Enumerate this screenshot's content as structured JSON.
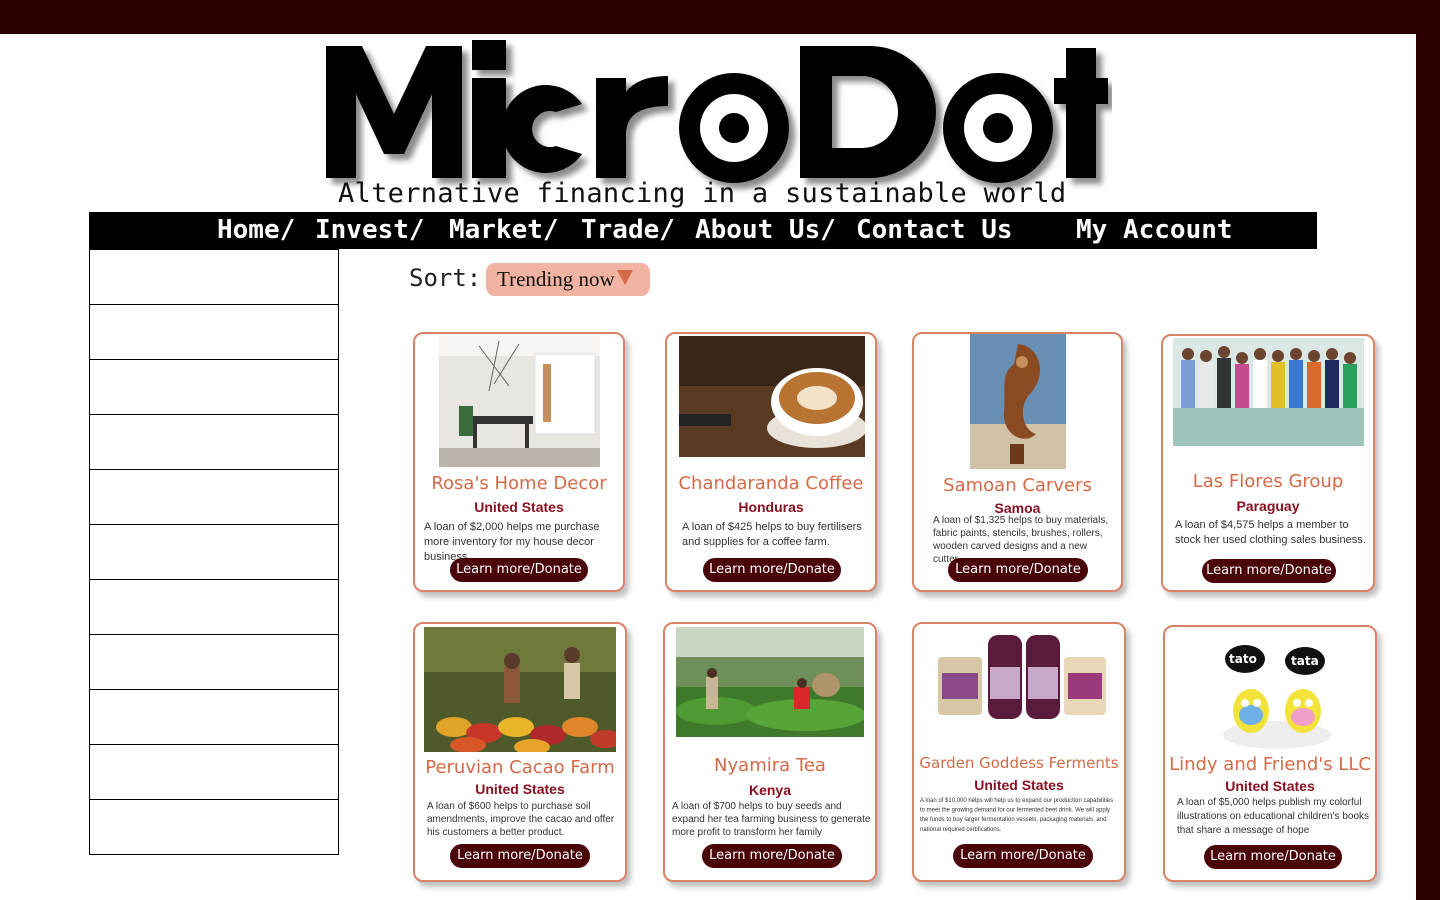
{
  "logo": {
    "text": "MicroDot",
    "tagline": "Alternative financing in a sustainable world"
  },
  "nav": {
    "items": [
      "Home/",
      "Invest/",
      "Market/",
      "Trade/",
      "About Us/",
      "Contact Us",
      "My Account"
    ]
  },
  "sort": {
    "label": "Sort:",
    "selected": "Trending now"
  },
  "button_label": "Learn more/Donate",
  "colors": {
    "accent": "#d56a48",
    "dark": "#2a0000",
    "button": "#4a0408",
    "sort_bg": "#f1b4a2"
  },
  "cards": [
    {
      "name": "Rosa's Home Decor",
      "country": "United States",
      "desc": "A loan of $2,000 helps me purchase more inventory for my house decor business.",
      "image": "interior-photo"
    },
    {
      "name": "Chandaranda Coffee",
      "country": "Honduras",
      "desc": "A loan of $425 helps to buy fertilisers and supplies for a coffee farm.",
      "image": "coffee-cup-photo"
    },
    {
      "name": "Samoan Carvers",
      "country": "Samoa",
      "desc": "A loan of $1,325 helps to buy materials, fabric paints, stencils, brushes, rollers, wooden carved designs and a new cutter.",
      "image": "wood-carving-photo"
    },
    {
      "name": "Las Flores Group",
      "country": "Paraguay",
      "desc": "A loan of $4,575 helps a member to stock her used clothing sales business.",
      "image": "group-photo"
    },
    {
      "name": "Peruvian Cacao Farm",
      "country": "United States",
      "desc": "A loan of $600 helps to purchase soil amendments, improve the cacao and offer  his customers a better product.",
      "image": "cacao-photo"
    },
    {
      "name": "Nyamira Tea",
      "country": "Kenya",
      "desc": "A loan of $700 helps to buy seeds and expand her tea farming business to generate more profit to transform her family",
      "image": "tea-farm-photo"
    },
    {
      "name": "Garden Goddess Ferments",
      "country": "United States",
      "desc": "A loan of $10,000 helps will help us to expand our production capabilities to meet the growing demand for our fermented beet drink. We will apply the funds to buy larger fermentation vessels, packaging materials, and national required certifications.",
      "image": "ferment-jars-photo"
    },
    {
      "name": "Lindy and Friend's LLC",
      "country": "United States",
      "desc": "A loan of $5,000 helps publish my colorful illustrations on educational children's books that share a message of hope",
      "image": "cartoon-illustration"
    }
  ],
  "book_labels": [
    "tato",
    "tata"
  ]
}
